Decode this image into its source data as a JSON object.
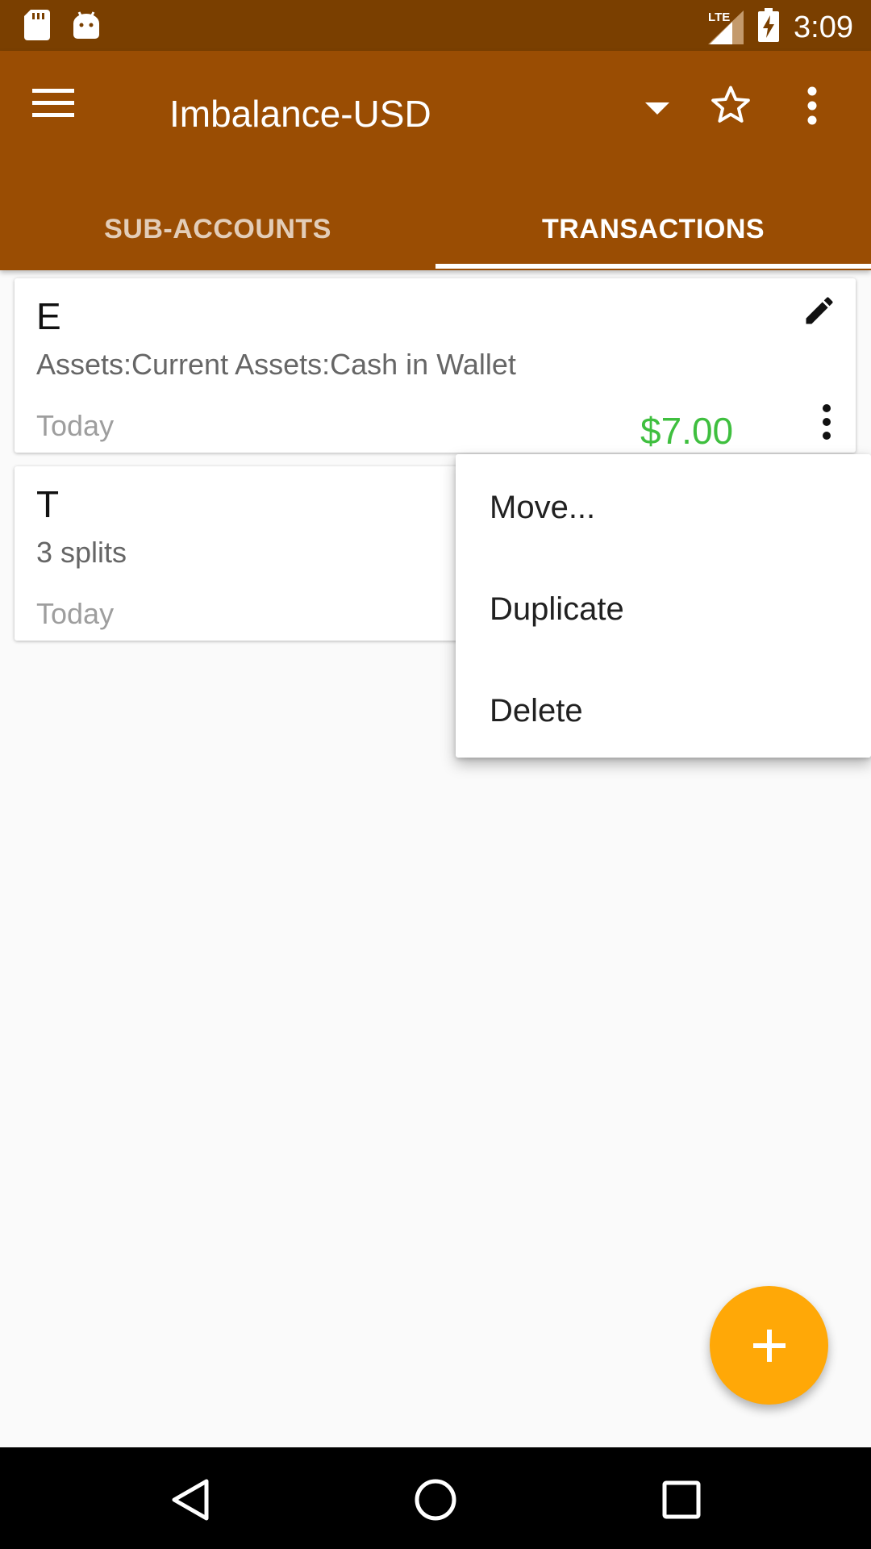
{
  "status_bar": {
    "time": "3:09",
    "network_label": "LTE"
  },
  "app_bar": {
    "title": "Imbalance-USD",
    "tabs": [
      {
        "label": "SUB-ACCOUNTS",
        "active": false
      },
      {
        "label": "TRANSACTIONS",
        "active": true
      }
    ]
  },
  "transactions": [
    {
      "title": "E",
      "subtitle": "Assets:Current Assets:Cash in Wallet",
      "date": "Today",
      "amount": "$7.00"
    },
    {
      "title": "T",
      "subtitle": "3 splits",
      "date": "Today"
    }
  ],
  "context_menu": {
    "items": [
      {
        "label": "Move..."
      },
      {
        "label": "Duplicate"
      },
      {
        "label": "Delete"
      }
    ]
  },
  "icons": {
    "sd_card": "sd-card-icon",
    "android": "android-icon",
    "signal": "signal-icon",
    "battery": "battery-charging-icon",
    "menu": "hamburger-menu-icon",
    "dropdown": "dropdown-arrow-icon",
    "star": "star-outline-icon",
    "overflow": "overflow-menu-icon",
    "edit": "pencil-icon",
    "add": "plus-icon",
    "back": "back-triangle-icon",
    "home": "home-circle-icon",
    "recents": "recents-square-icon"
  },
  "colors": {
    "status_bar": "#7A3F00",
    "app_bar": "#9A4D03",
    "amount_positive": "#3FBF3F",
    "fab": "#FFA807"
  }
}
